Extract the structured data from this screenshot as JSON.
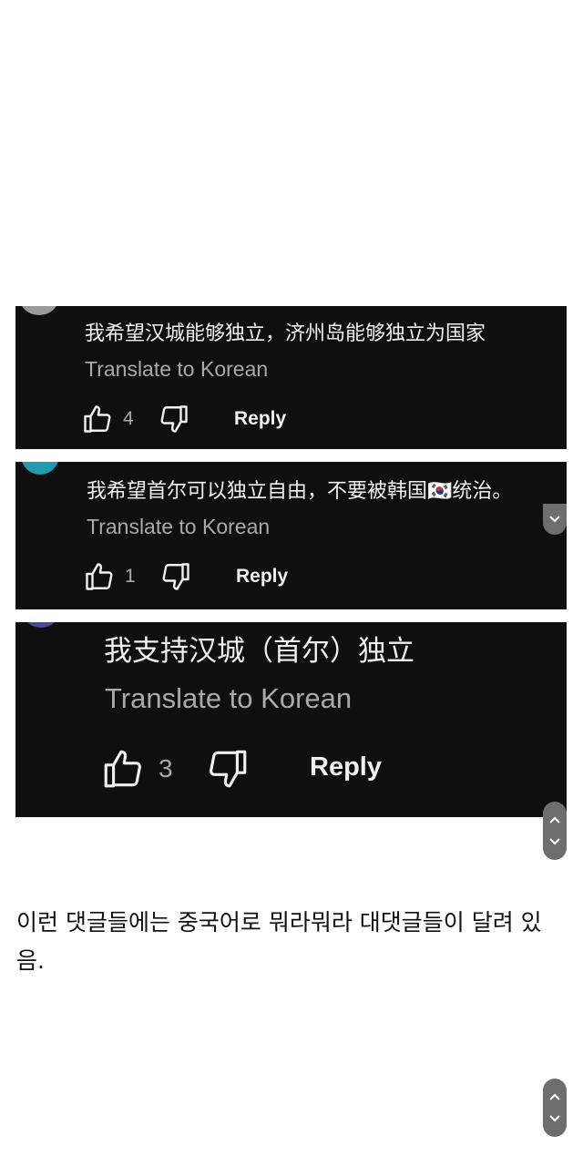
{
  "comments": [
    {
      "text": "我希望汉城能够独立，济州岛能够独立为国家",
      "translate": "Translate to Korean",
      "likes": "4",
      "reply": "Reply",
      "avatar_color": "#9a9a9a"
    },
    {
      "text": "我希望首尔可以独立自由，不要被韩国🇰🇷统治。",
      "translate": "Translate to Korean",
      "likes": "1",
      "reply": "Reply",
      "avatar_color": "#1e9bb0"
    },
    {
      "text": "我支持汉城（首尔）独立",
      "translate": "Translate to Korean",
      "likes": "3",
      "reply": "Reply",
      "avatar_color": "#4a4a9a"
    }
  ],
  "post": {
    "caption": "이런 댓글들에는 중국어로 뭐라뭐라 대댓글들이 달려 있음."
  },
  "icons": {
    "like": "thumbs-up-icon",
    "dislike": "thumbs-down-icon",
    "scroll_up": "chevron-up-icon",
    "scroll_down": "chevron-down-icon"
  },
  "colors": {
    "panel_bg": "#0f0f0f",
    "text": "#f1f1f1",
    "muted": "#aaaaaa",
    "scroll_button": "#6e6e6e"
  }
}
